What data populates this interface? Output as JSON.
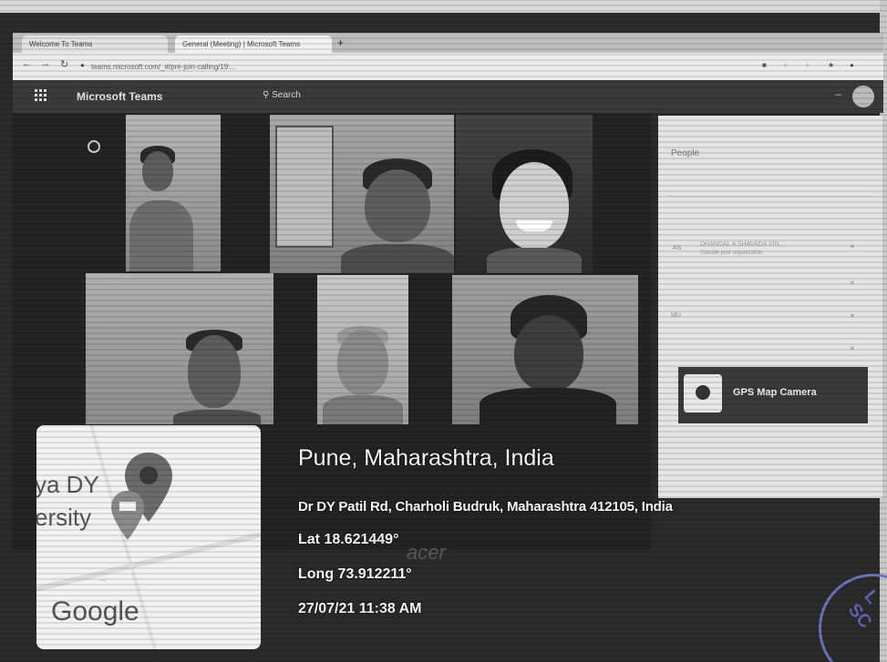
{
  "browser": {
    "tabs": [
      {
        "label": "Welcome To Teams"
      },
      {
        "label": "General (Meeting) | Microsoft Teams"
      }
    ],
    "url": "teams.microsoft.com/_#/pre-join-calling/19:..."
  },
  "teams": {
    "app_title": "Microsoft Teams",
    "search_label": "Search"
  },
  "people_panel": {
    "title": "People",
    "rows": [
      {
        "initials": "AS",
        "name": "DHANDAL A SHAVADA VIN...",
        "sub": "Outside your organization"
      },
      {
        "initials": "",
        "name": ""
      },
      {
        "initials": "MU",
        "name": ""
      },
      {
        "initials": "",
        "name": ""
      }
    ]
  },
  "gps_camera": {
    "app_name": "GPS Map Camera"
  },
  "map_thumb": {
    "place_text_line1": "ya DY",
    "place_text_line2": "ersity",
    "google_label": "Google",
    "dots": "..."
  },
  "location": {
    "city": "Pune, Maharashtra, India",
    "address": "Dr DY Patil Rd, Charholi Budruk, Maharashtra 412105, India",
    "lat": "Lat 18.621449°",
    "long": "Long 73.912211°",
    "datetime": "27/07/21 11:38 AM"
  },
  "monitor_brand": "acer",
  "stamp_text": "L SC",
  "colors": {
    "teams_bar": "#3a3a3a",
    "overlay_text": "#ffffff",
    "stamp_ink": "#5c64b0"
  }
}
